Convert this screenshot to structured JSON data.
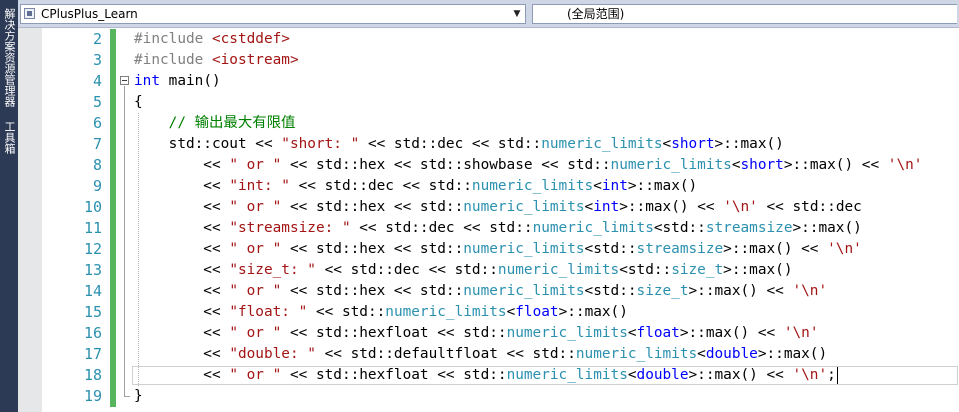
{
  "side_tabs": [
    "解决方案资源管理器",
    "工具箱"
  ],
  "navbar": {
    "project": "CPlusPlus_Learn",
    "scope": "(全局范围)"
  },
  "editor": {
    "lines": [
      {
        "n": "2",
        "tokens": [
          {
            "t": "#include ",
            "c": "pp"
          },
          {
            "t": "<cstddef>",
            "c": "str"
          }
        ]
      },
      {
        "n": "3",
        "tokens": [
          {
            "t": "#include ",
            "c": "pp"
          },
          {
            "t": "<iostream>",
            "c": "str"
          }
        ]
      },
      {
        "n": "4",
        "tokens": [
          {
            "t": "int",
            "c": "kw"
          },
          {
            "t": " main()",
            "c": ""
          }
        ]
      },
      {
        "n": "5",
        "tokens": [
          {
            "t": "{",
            "c": ""
          }
        ]
      },
      {
        "n": "6",
        "tokens": [
          {
            "t": "    ",
            "c": ""
          },
          {
            "t": "// 输出最大有限值",
            "c": "com"
          }
        ]
      },
      {
        "n": "7",
        "tokens": [
          {
            "t": "    std::cout << ",
            "c": ""
          },
          {
            "t": "\"short: \"",
            "c": "str"
          },
          {
            "t": " << std::dec << std::",
            "c": ""
          },
          {
            "t": "numeric_limits",
            "c": "ty"
          },
          {
            "t": "<",
            "c": ""
          },
          {
            "t": "short",
            "c": "kw"
          },
          {
            "t": ">::max()",
            "c": ""
          }
        ]
      },
      {
        "n": "8",
        "tokens": [
          {
            "t": "        << ",
            "c": ""
          },
          {
            "t": "\" or \"",
            "c": "str"
          },
          {
            "t": " << std::hex << std::showbase << std::",
            "c": ""
          },
          {
            "t": "numeric_limits",
            "c": "ty"
          },
          {
            "t": "<",
            "c": ""
          },
          {
            "t": "short",
            "c": "kw"
          },
          {
            "t": ">::max() << ",
            "c": ""
          },
          {
            "t": "'\\n'",
            "c": "str"
          }
        ]
      },
      {
        "n": "9",
        "tokens": [
          {
            "t": "        << ",
            "c": ""
          },
          {
            "t": "\"int: \"",
            "c": "str"
          },
          {
            "t": " << std::dec << std::",
            "c": ""
          },
          {
            "t": "numeric_limits",
            "c": "ty"
          },
          {
            "t": "<",
            "c": ""
          },
          {
            "t": "int",
            "c": "kw"
          },
          {
            "t": ">::max()",
            "c": ""
          }
        ]
      },
      {
        "n": "10",
        "tokens": [
          {
            "t": "        << ",
            "c": ""
          },
          {
            "t": "\" or \"",
            "c": "str"
          },
          {
            "t": " << std::hex << std::",
            "c": ""
          },
          {
            "t": "numeric_limits",
            "c": "ty"
          },
          {
            "t": "<",
            "c": ""
          },
          {
            "t": "int",
            "c": "kw"
          },
          {
            "t": ">::max() << ",
            "c": ""
          },
          {
            "t": "'\\n'",
            "c": "str"
          },
          {
            "t": " << std::dec",
            "c": ""
          }
        ]
      },
      {
        "n": "11",
        "tokens": [
          {
            "t": "        << ",
            "c": ""
          },
          {
            "t": "\"streamsize: \"",
            "c": "str"
          },
          {
            "t": " << std::dec << std::",
            "c": ""
          },
          {
            "t": "numeric_limits",
            "c": "ty"
          },
          {
            "t": "<std::",
            "c": ""
          },
          {
            "t": "streamsize",
            "c": "ty"
          },
          {
            "t": ">::max()",
            "c": ""
          }
        ]
      },
      {
        "n": "12",
        "tokens": [
          {
            "t": "        << ",
            "c": ""
          },
          {
            "t": "\" or \"",
            "c": "str"
          },
          {
            "t": " << std::hex << std::",
            "c": ""
          },
          {
            "t": "numeric_limits",
            "c": "ty"
          },
          {
            "t": "<std::",
            "c": ""
          },
          {
            "t": "streamsize",
            "c": "ty"
          },
          {
            "t": ">::max() << ",
            "c": ""
          },
          {
            "t": "'\\n'",
            "c": "str"
          }
        ]
      },
      {
        "n": "13",
        "tokens": [
          {
            "t": "        << ",
            "c": ""
          },
          {
            "t": "\"size_t: \"",
            "c": "str"
          },
          {
            "t": " << std::dec << std::",
            "c": ""
          },
          {
            "t": "numeric_limits",
            "c": "ty"
          },
          {
            "t": "<std::",
            "c": ""
          },
          {
            "t": "size_t",
            "c": "ty"
          },
          {
            "t": ">::max()",
            "c": ""
          }
        ]
      },
      {
        "n": "14",
        "tokens": [
          {
            "t": "        << ",
            "c": ""
          },
          {
            "t": "\" or \"",
            "c": "str"
          },
          {
            "t": " << std::hex << std::",
            "c": ""
          },
          {
            "t": "numeric_limits",
            "c": "ty"
          },
          {
            "t": "<std::",
            "c": ""
          },
          {
            "t": "size_t",
            "c": "ty"
          },
          {
            "t": ">::max() << ",
            "c": ""
          },
          {
            "t": "'\\n'",
            "c": "str"
          }
        ]
      },
      {
        "n": "15",
        "tokens": [
          {
            "t": "        << ",
            "c": ""
          },
          {
            "t": "\"float: \"",
            "c": "str"
          },
          {
            "t": " << std::",
            "c": ""
          },
          {
            "t": "numeric_limits",
            "c": "ty"
          },
          {
            "t": "<",
            "c": ""
          },
          {
            "t": "float",
            "c": "kw"
          },
          {
            "t": ">::max()",
            "c": ""
          }
        ]
      },
      {
        "n": "16",
        "tokens": [
          {
            "t": "        << ",
            "c": ""
          },
          {
            "t": "\" or \"",
            "c": "str"
          },
          {
            "t": " << std::hexfloat << std::",
            "c": ""
          },
          {
            "t": "numeric_limits",
            "c": "ty"
          },
          {
            "t": "<",
            "c": ""
          },
          {
            "t": "float",
            "c": "kw"
          },
          {
            "t": ">::max() << ",
            "c": ""
          },
          {
            "t": "'\\n'",
            "c": "str"
          }
        ]
      },
      {
        "n": "17",
        "tokens": [
          {
            "t": "        << ",
            "c": ""
          },
          {
            "t": "\"double: \"",
            "c": "str"
          },
          {
            "t": " << std::defaultfloat << std::",
            "c": ""
          },
          {
            "t": "numeric_limits",
            "c": "ty"
          },
          {
            "t": "<",
            "c": ""
          },
          {
            "t": "double",
            "c": "kw"
          },
          {
            "t": ">::max()",
            "c": ""
          }
        ]
      },
      {
        "n": "18",
        "tokens": [
          {
            "t": "        << ",
            "c": ""
          },
          {
            "t": "\" or \"",
            "c": "str"
          },
          {
            "t": " << std::hexfloat << std::",
            "c": ""
          },
          {
            "t": "numeric_limits",
            "c": "ty"
          },
          {
            "t": "<",
            "c": ""
          },
          {
            "t": "double",
            "c": "kw"
          },
          {
            "t": ">::max() << ",
            "c": ""
          },
          {
            "t": "'\\n'",
            "c": "str"
          },
          {
            "t": ";",
            "c": ""
          }
        ]
      },
      {
        "n": "19",
        "tokens": [
          {
            "t": "}",
            "c": ""
          }
        ]
      }
    ]
  }
}
